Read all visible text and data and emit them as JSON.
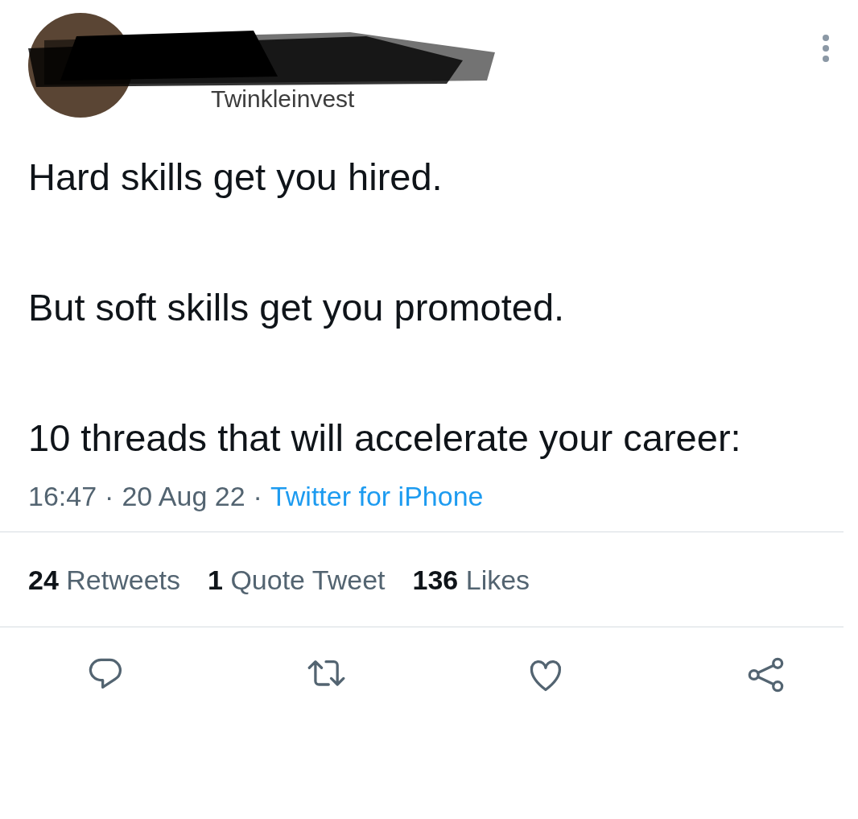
{
  "author": {
    "handle": "Twinkleinvest"
  },
  "paragraphs": [
    "Hard skills get you hired.",
    "But soft skills get you promoted.",
    "10 threads that will accelerate your career:"
  ],
  "meta": {
    "time": "16:47",
    "separator": "·",
    "date": "20 Aug 22",
    "source": "Twitter for iPhone"
  },
  "stats": [
    {
      "count": "24",
      "label": "Retweets"
    },
    {
      "count": "1",
      "label": "Quote Tweet"
    },
    {
      "count": "136",
      "label": "Likes"
    }
  ],
  "actions": [
    {
      "kind": "reply"
    },
    {
      "kind": "retweet"
    },
    {
      "kind": "like"
    },
    {
      "kind": "share"
    }
  ]
}
